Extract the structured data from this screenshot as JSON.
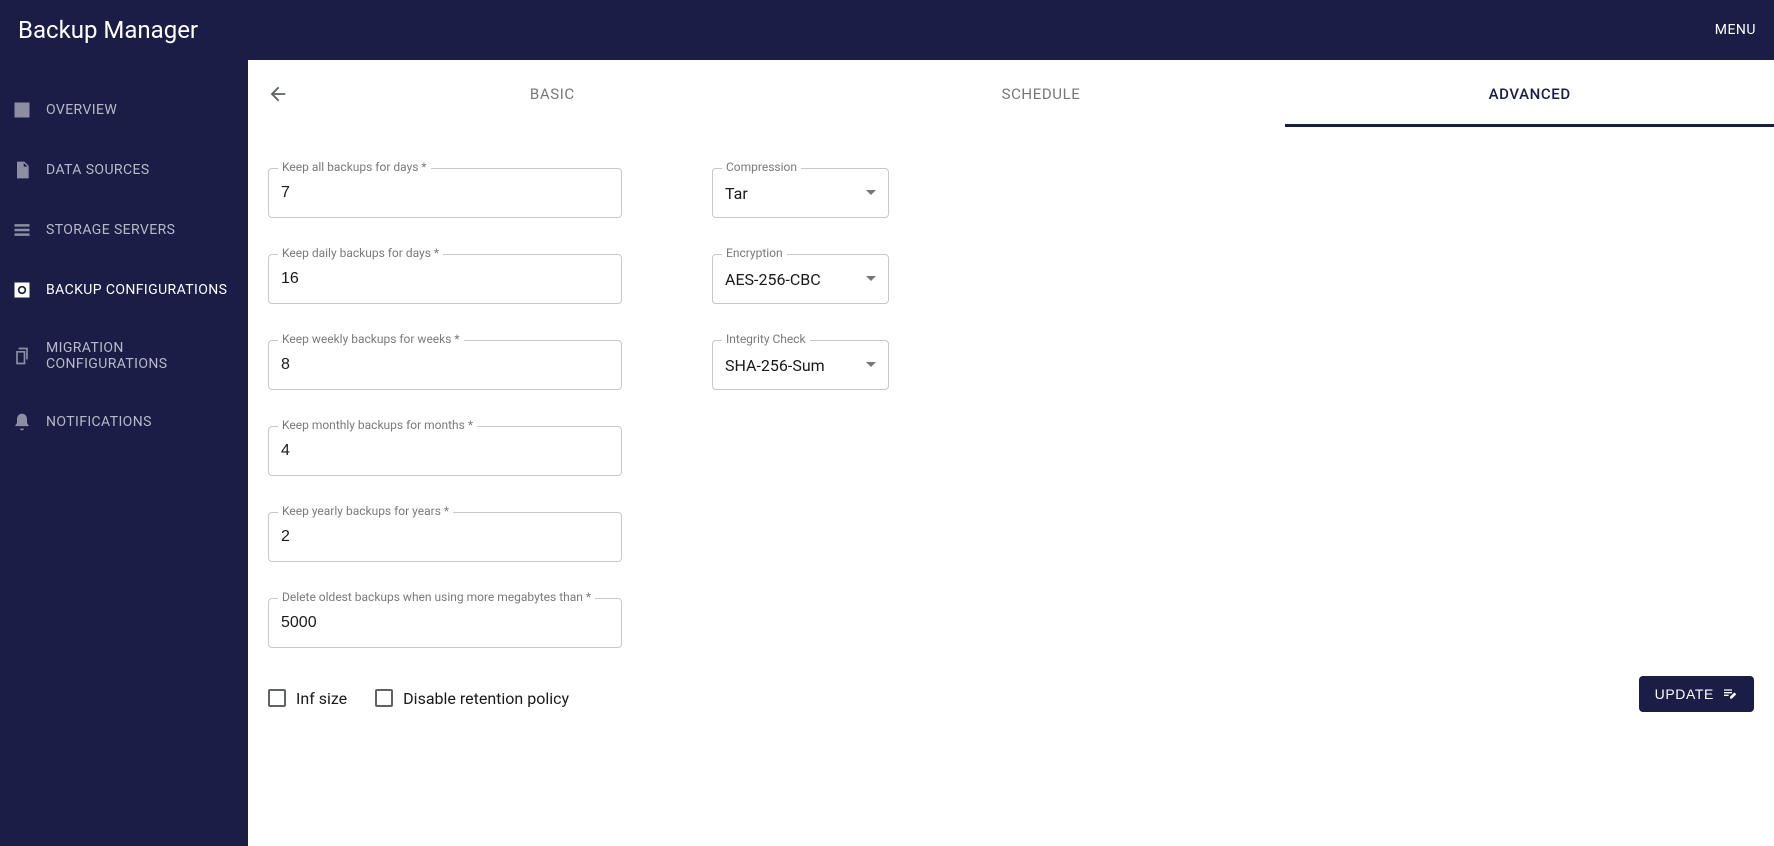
{
  "header": {
    "title": "Backup Manager",
    "menu": "MENU"
  },
  "sidebar": {
    "items": [
      {
        "label": "OVERVIEW",
        "icon": "chart-bar-icon"
      },
      {
        "label": "DATA SOURCES",
        "icon": "file-icon"
      },
      {
        "label": "STORAGE SERVERS",
        "icon": "list-icon"
      },
      {
        "label": "BACKUP CONFIGURATIONS",
        "icon": "gear-box-icon"
      },
      {
        "label": "MIGRATION CONFIGURATIONS",
        "icon": "copy-icon"
      },
      {
        "label": "NOTIFICATIONS",
        "icon": "bell-icon"
      }
    ],
    "active_index": 3
  },
  "tabs": {
    "items": [
      "BASIC",
      "SCHEDULE",
      "ADVANCED"
    ],
    "active_index": 2
  },
  "form": {
    "left": [
      {
        "label": "Keep all backups for days *",
        "value": "7"
      },
      {
        "label": "Keep daily backups for days *",
        "value": "16"
      },
      {
        "label": "Keep weekly backups for weeks *",
        "value": "8"
      },
      {
        "label": "Keep monthly backups for months *",
        "value": "4"
      },
      {
        "label": "Keep yearly backups for years *",
        "value": "2"
      },
      {
        "label": "Delete oldest backups when using more megabytes than *",
        "value": "5000"
      }
    ],
    "right": [
      {
        "label": "Compression",
        "value": "Tar"
      },
      {
        "label": "Encryption",
        "value": "AES-256-CBC"
      },
      {
        "label": "Integrity Check",
        "value": "SHA-256-Sum"
      }
    ]
  },
  "checks": {
    "inf_size": "Inf size",
    "disable_retention": "Disable retention policy"
  },
  "buttons": {
    "update": "UPDATE"
  }
}
